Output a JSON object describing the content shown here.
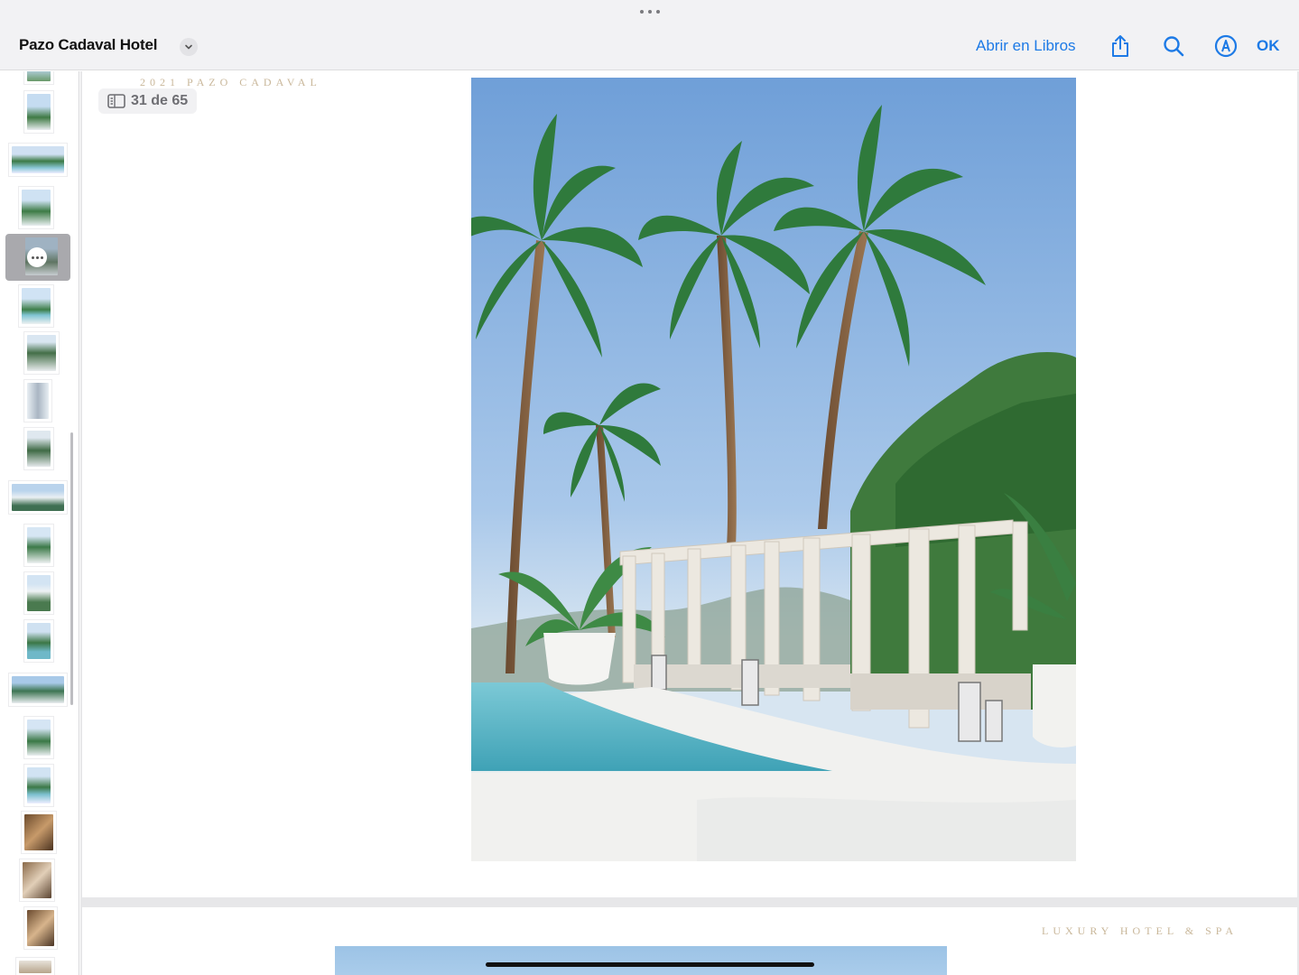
{
  "topbar": {
    "title": "Pazo Cadaval Hotel",
    "open_in_books": "Abrir en Libros",
    "ok": "OK",
    "icons": [
      "share-icon",
      "search-icon",
      "markup-icon"
    ]
  },
  "page_indicator": {
    "label": "31 de 65",
    "current": 31,
    "total": 65
  },
  "pages": {
    "header_text": "2021 PAZO CADAVAL",
    "next_page_header": "LUXURY HOTEL & SPA"
  },
  "colors": {
    "accent": "#1d7ae6",
    "toolbar_bg": "#f2f2f4",
    "serif_gold": "#c9b79a"
  }
}
